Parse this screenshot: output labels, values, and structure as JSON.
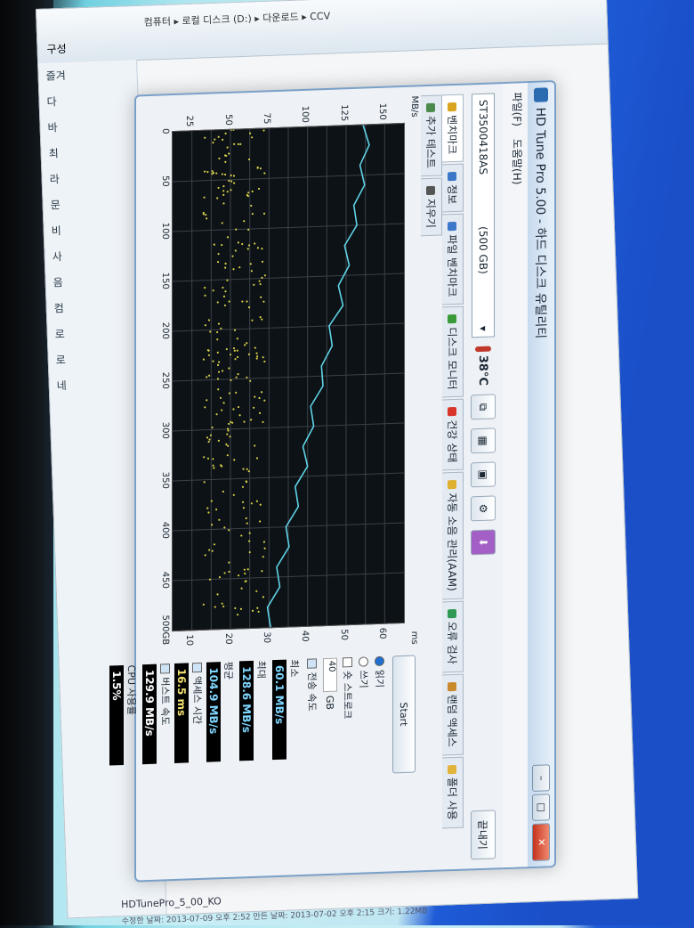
{
  "explorer": {
    "organize": "구성",
    "address": "컴퓨터 ▸ 로컬 디스크 (D:) ▸ 다운로드 ▸ CCV",
    "tree_items": [
      "즐겨",
      "다",
      "바",
      "최",
      "라",
      "문",
      "비",
      "사",
      "음",
      "컴",
      "로",
      "로",
      "네"
    ],
    "statusbar_file": "HDTunePro_5_00_KO",
    "statusbar_meta": "수정한 날짜: 2013-07-09 오후 2:52   만든 날짜: 2013-07-02 오후 2:15   크기: 1.22MB"
  },
  "app": {
    "title": "HD Tune Pro 5.00 - 하드 디스크 유틸리티",
    "menu": [
      "파일(F)",
      "도움말(H)"
    ],
    "drive": {
      "name": "ST3500418AS",
      "size": "(500 GB)"
    },
    "temperature": "38°C",
    "exit_label": "끝내기",
    "tabs": [
      {
        "label": "벤치마크",
        "icon": "benchmark-icon",
        "color": "#d9a521",
        "active": true
      },
      {
        "label": "정보",
        "icon": "info-icon",
        "color": "#3b78c9"
      },
      {
        "label": "파일 벤치마크",
        "icon": "file-benchmark-icon",
        "color": "#3b78c9"
      },
      {
        "label": "디스크 모니터",
        "icon": "disk-monitor-icon",
        "color": "#3a9a3a"
      },
      {
        "label": "건강 상태",
        "icon": "health-icon",
        "color": "#d8362b"
      },
      {
        "label": "자동 소음 관리(AAM)",
        "icon": "aam-icon",
        "color": "#e0b030"
      },
      {
        "label": "오류 검사",
        "icon": "error-scan-icon",
        "color": "#2e9a54"
      },
      {
        "label": "랜덤 액세스",
        "icon": "random-access-icon",
        "color": "#c98a2b"
      },
      {
        "label": "폴더 사용",
        "icon": "folder-icon",
        "color": "#e3b43b"
      },
      {
        "label": "추가 테스트",
        "icon": "extra-tests-icon",
        "color": "#4a8a4a"
      },
      {
        "label": "지우기",
        "icon": "erase-icon",
        "color": "#555555"
      }
    ],
    "graph": {
      "y_unit_left": "MB/s",
      "y_unit_right": "ms",
      "y_ticks_left": [
        "150",
        "125",
        "100",
        "75",
        "50",
        "25"
      ],
      "y_ticks_right": [
        "60",
        "50",
        "40",
        "30",
        "20",
        "10"
      ],
      "x_ticks": [
        "0",
        "50",
        "100",
        "150",
        "200",
        "250",
        "300",
        "350",
        "400",
        "450",
        "500GB"
      ]
    },
    "side": {
      "start": "Start",
      "read": "읽기",
      "write": "쓰기",
      "short_stroke": "숏 스트로크",
      "short_stroke_value": "40",
      "gb": "GB",
      "transfer_rate": "전송 속도",
      "min_label": "최소",
      "min_value": "60.1 MB/s",
      "max_label": "최대",
      "max_value": "128.6 MB/s",
      "avg_label": "평균",
      "avg_value": "104.9 MB/s",
      "access_time": "액세스 시간",
      "access_value": "16.5 ms",
      "burst_rate": "버스트 속도",
      "burst_value": "129.9 MB/s",
      "cpu_usage": "CPU 사용률",
      "cpu_value": "1.5%"
    }
  },
  "chart_data": {
    "type": "line",
    "x_label": "",
    "x_unit": "GB",
    "xlim": [
      0,
      500
    ],
    "y_left_unit": "MB/s",
    "ylim_left": [
      0,
      150
    ],
    "y_right_unit": "ms",
    "ylim_right": [
      0,
      60
    ],
    "grid": true,
    "series": [
      {
        "name": "",
        "axis": "left",
        "color": "#5fd3e6",
        "x": [
          0,
          20,
          40,
          60,
          80,
          100,
          120,
          140,
          160,
          180,
          200,
          220,
          240,
          260,
          280,
          300,
          320,
          340,
          360,
          380,
          400,
          420,
          440,
          460,
          480,
          500
        ],
        "y": [
          126,
          125,
          124,
          122,
          120,
          117,
          114,
          112,
          110,
          108,
          104,
          101,
          99,
          95,
          92,
          89,
          87,
          85,
          82,
          79,
          76,
          73,
          70,
          67,
          64,
          61
        ]
      }
    ],
    "scatter_access_ms": {
      "axis": "right",
      "color": "#d8d24a",
      "x_range_gb": [
        0,
        500
      ],
      "y_range_ms": [
        8,
        24
      ]
    }
  }
}
